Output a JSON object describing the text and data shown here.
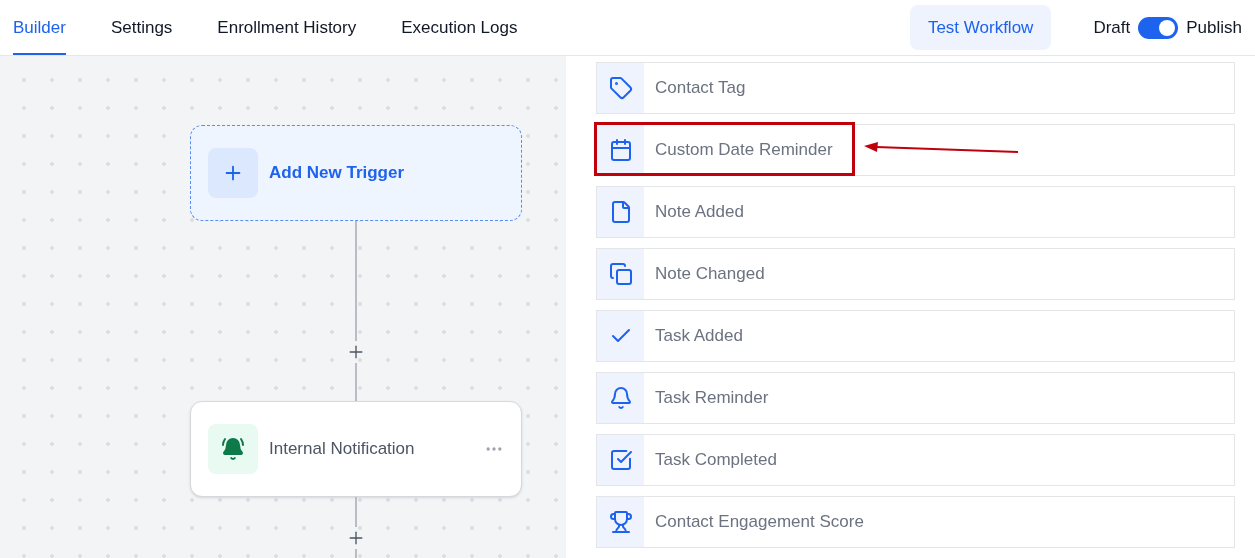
{
  "tabs": [
    {
      "label": "Builder",
      "selected": true
    },
    {
      "label": "Settings",
      "selected": false
    },
    {
      "label": "Enrollment History",
      "selected": false
    },
    {
      "label": "Execution Logs",
      "selected": false
    }
  ],
  "test_button": "Test Workflow",
  "publish_toggle": {
    "off_label": "Draft",
    "on_label": "Publish",
    "on": true
  },
  "canvas": {
    "trigger": {
      "label": "Add New Trigger"
    },
    "action": {
      "label": "Internal Notification"
    }
  },
  "triggers": [
    {
      "label": "Contact Tag",
      "highlighted": false
    },
    {
      "label": "Custom Date Reminder",
      "highlighted": true
    },
    {
      "label": "Note Added",
      "highlighted": false
    },
    {
      "label": "Note Changed",
      "highlighted": false
    },
    {
      "label": "Task Added",
      "highlighted": false
    },
    {
      "label": "Task Reminder",
      "highlighted": false
    },
    {
      "label": "Task Completed",
      "highlighted": false
    },
    {
      "label": "Contact Engagement Score",
      "highlighted": false
    }
  ]
}
